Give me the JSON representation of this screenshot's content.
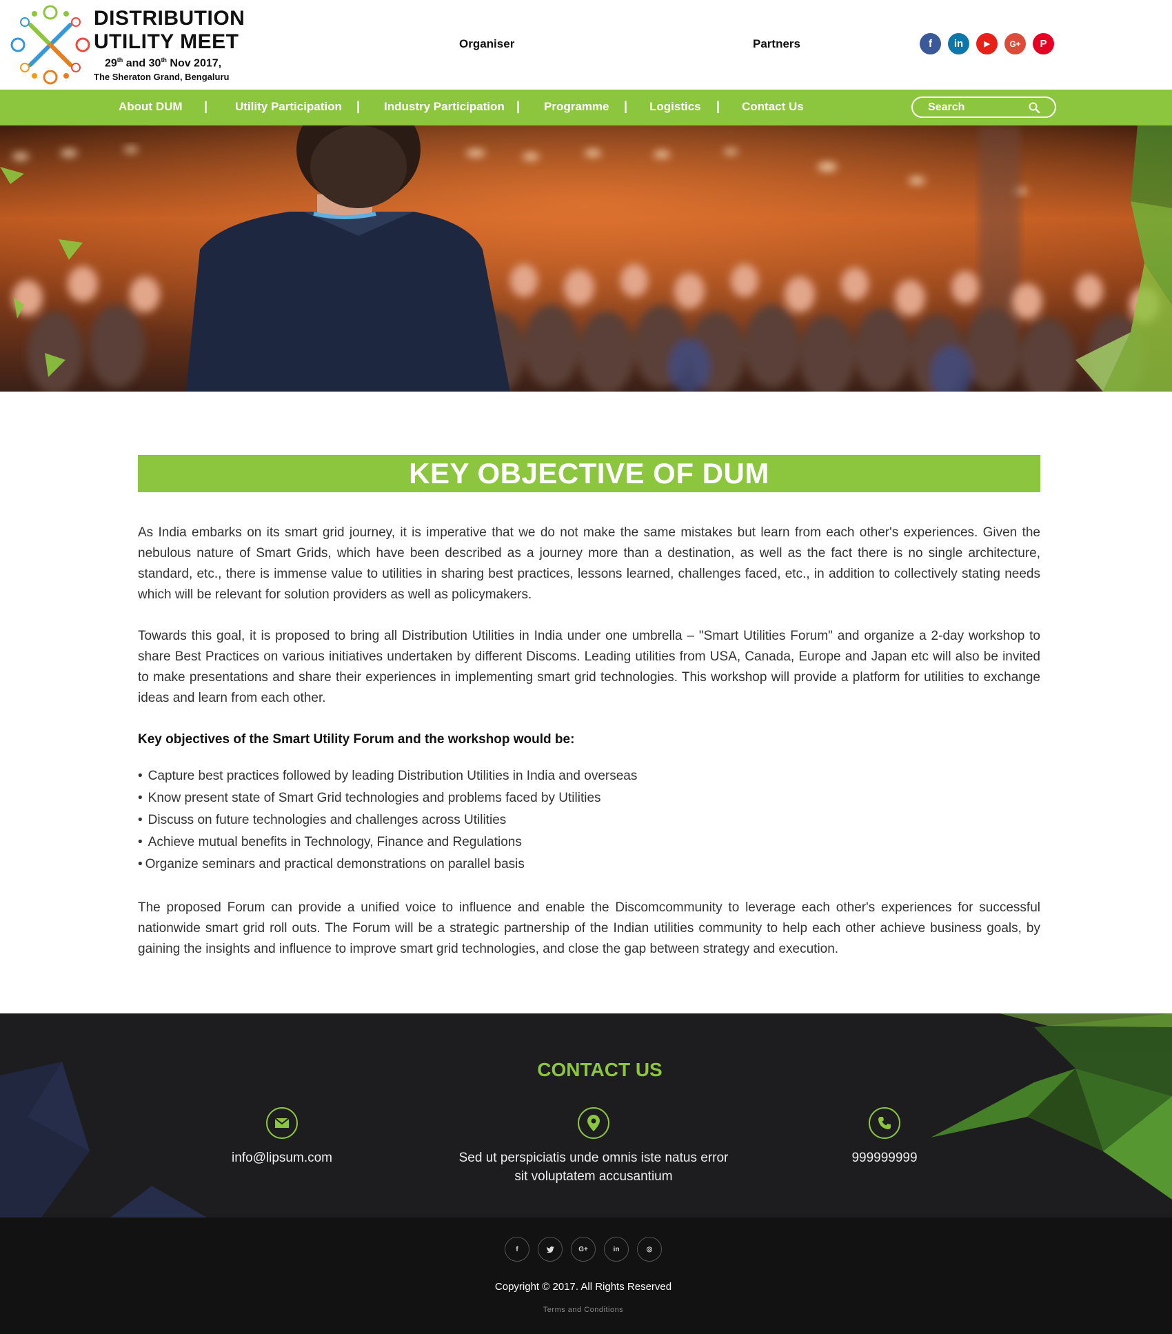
{
  "logo": {
    "title_line1": "DISTRIBUTION",
    "title_line2": "UTILITY MEET",
    "date_day1": "29",
    "date_sup1": "th",
    "date_and": " and 30",
    "date_sup2": "th",
    "date_rest": " Nov 2017,",
    "venue": "The Sheraton Grand, Bengaluru"
  },
  "top_links": {
    "organiser": "Organiser",
    "partners": "Partners"
  },
  "social_top": [
    {
      "icon": "facebook-icon",
      "glyph": "f",
      "color": "#3b5998"
    },
    {
      "icon": "linkedin-icon",
      "glyph": "in",
      "color": "#0e76a8"
    },
    {
      "icon": "youtube-icon",
      "glyph": "▶",
      "color": "#e62117"
    },
    {
      "icon": "google-plus-icon",
      "glyph": "G+",
      "color": "#dd4b39"
    },
    {
      "icon": "pinterest-icon",
      "glyph": "P",
      "color": "#e60023"
    }
  ],
  "nav": {
    "items": [
      "About DUM",
      "Utility Participation",
      "Industry Participation",
      "Programme",
      "Logistics",
      "Contact Us"
    ],
    "separator": "|",
    "search_placeholder": "Search"
  },
  "colors": {
    "accent": "#8cc63f",
    "footer": "#1d1d1f",
    "footer_bottom": "#121212"
  },
  "main": {
    "heading": "KEY OBJECTIVE OF DUM",
    "para1": "As India embarks on its smart grid journey, it is imperative that we do not make the same mistakes but learn from each other's experiences. Given the nebulous nature of Smart Grids, which have been described as a journey more than a destination, as well as the fact there is no single architecture, standard, etc., there is immense value to utilities in sharing best practices, lessons learned, challenges faced, etc., in addition to collectively stating needs which will be relevant for solution providers as well as policymakers.",
    "para2": "Towards this goal, it is proposed to bring all Distribution Utilities in India under one umbrella – \"Smart Utilities Forum\" and organize a 2-day workshop to share Best Practices on various initiatives undertaken by different Discoms. Leading utilities from USA, Canada, Europe and Japan etc will also be invited to make presentations and share their experiences in implementing smart grid technologies. This workshop will provide a platform for utilities to exchange ideas and learn from each other.",
    "objectives_heading": "Key objectives of the Smart Utility Forum and the workshop would be:",
    "objectives": [
      "Capture best practices followed by leading Distribution Utilities in India and overseas",
      "Know present state of Smart Grid technologies and problems faced by Utilities",
      "Discuss on future technologies and challenges across Utilities",
      "Achieve mutual benefits in Technology, Finance and Regulations",
      "Organize seminars and practical demonstrations on parallel basis"
    ],
    "para3": "The proposed Forum can provide a unified voice to influence and enable the Discomcommunity to leverage each other's experiences for successful nationwide smart grid roll outs. The Forum will be a strategic  partnership of the Indian utilities community to help each other achieve business goals, by gaining the insights and influence to improve smart grid technologies, and close the gap between strategy and execution."
  },
  "contact": {
    "title": "CONTACT US",
    "email": "info@lipsum.com",
    "address_line1": "Sed ut perspiciatis unde omnis iste natus error",
    "address_line2": "sit voluptatem accusantium",
    "phone": "999999999"
  },
  "footer": {
    "social": [
      {
        "icon": "facebook-icon",
        "glyph": "f"
      },
      {
        "icon": "twitter-icon",
        "glyph": "🐦"
      },
      {
        "icon": "google-plus-icon",
        "glyph": "G+"
      },
      {
        "icon": "linkedin-icon",
        "glyph": "in"
      },
      {
        "icon": "instagram-icon",
        "glyph": "◎"
      }
    ],
    "copyright": "Copyright © 2017. All Rights Reserved",
    "terms": "Terms and Conditions"
  }
}
